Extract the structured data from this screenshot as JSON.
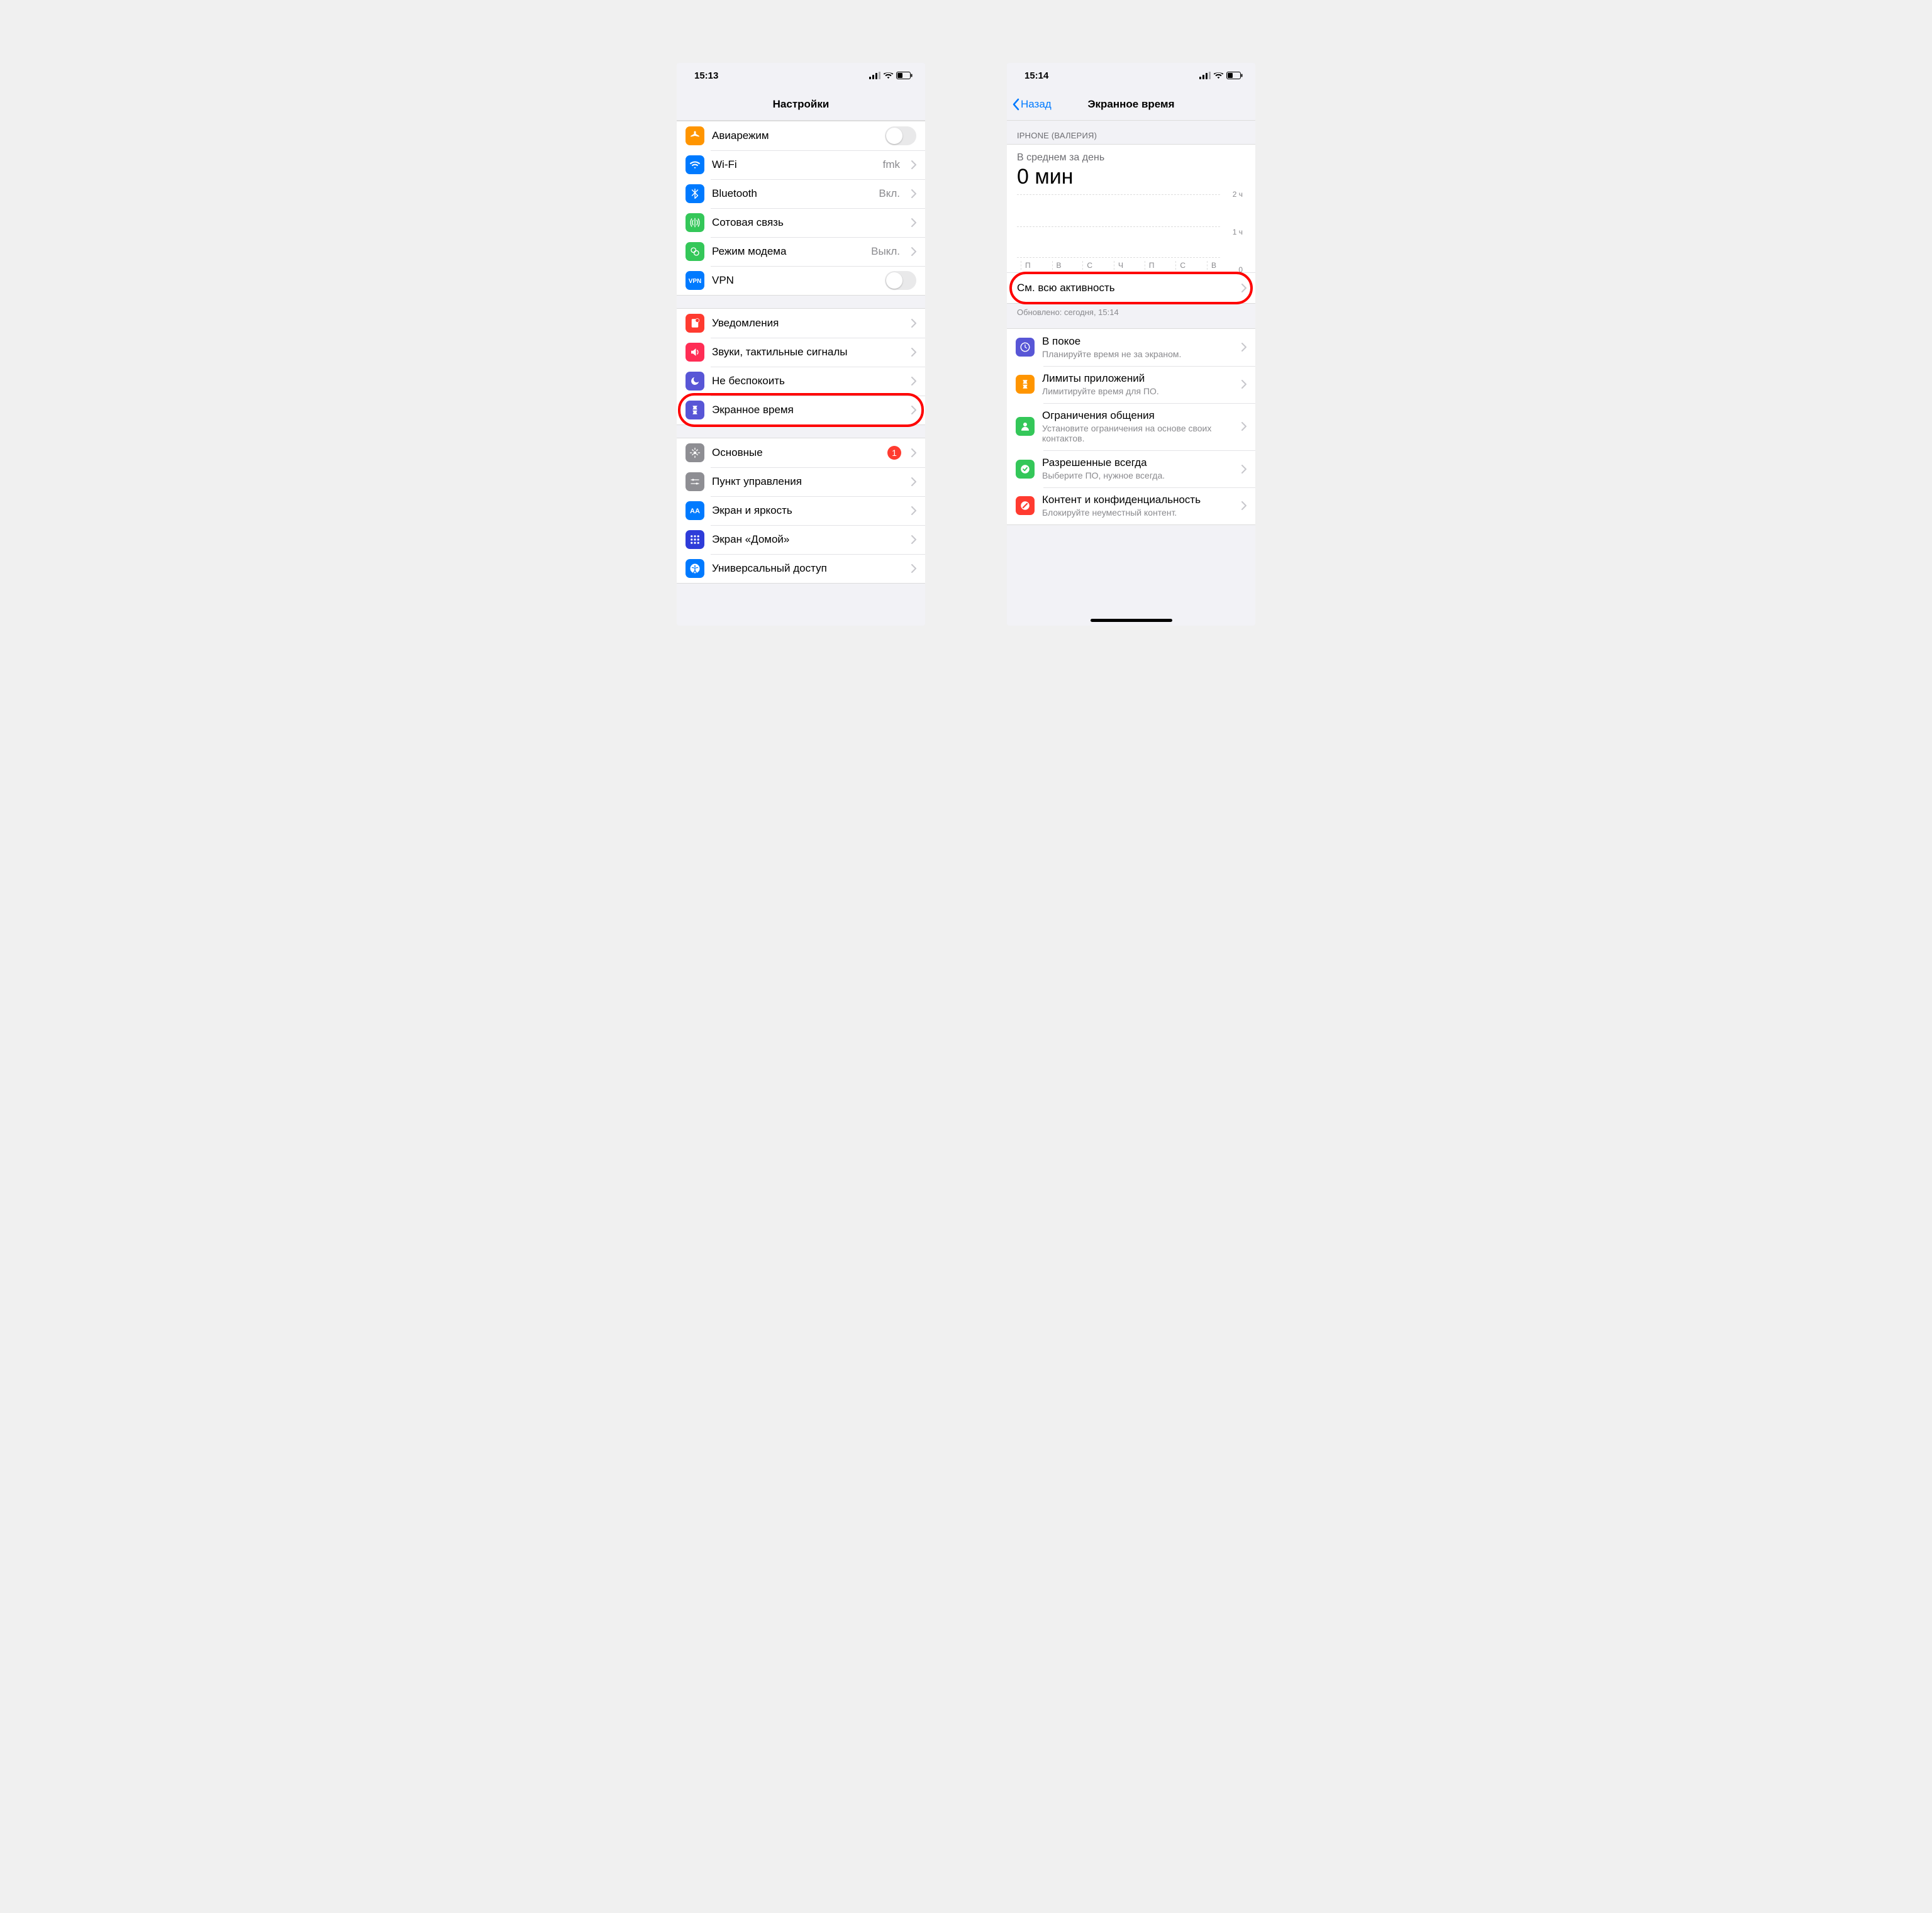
{
  "left": {
    "status": {
      "time": "15:13"
    },
    "nav": {
      "title": "Настройки"
    },
    "group1": [
      {
        "icon": "airplane",
        "color": "#ff9500",
        "label": "Авиарежим",
        "kind": "toggle"
      },
      {
        "icon": "wifi",
        "color": "#007aff",
        "label": "Wi-Fi",
        "value": "fmk",
        "kind": "chevron"
      },
      {
        "icon": "bluetooth",
        "color": "#007aff",
        "label": "Bluetooth",
        "value": "Вкл.",
        "kind": "chevron"
      },
      {
        "icon": "cellular",
        "color": "#34c759",
        "label": "Сотовая связь",
        "kind": "chevron"
      },
      {
        "icon": "hotspot",
        "color": "#34c759",
        "label": "Режим модема",
        "value": "Выкл.",
        "kind": "chevron"
      },
      {
        "icon": "vpn",
        "color": "#007aff",
        "label": "VPN",
        "kind": "toggle"
      }
    ],
    "group2": [
      {
        "icon": "notifications",
        "color": "#ff3b30",
        "label": "Уведомления",
        "kind": "chevron"
      },
      {
        "icon": "sounds",
        "color": "#ff2d55",
        "label": "Звуки, тактильные сигналы",
        "kind": "chevron"
      },
      {
        "icon": "dnd",
        "color": "#5856d6",
        "label": "Не беспокоить",
        "kind": "chevron"
      },
      {
        "icon": "screentime",
        "color": "#5856d6",
        "label": "Экранное время",
        "kind": "chevron",
        "highlight": true
      }
    ],
    "group3": [
      {
        "icon": "general",
        "color": "#8e8e93",
        "label": "Основные",
        "badge": "1",
        "kind": "chevron"
      },
      {
        "icon": "control",
        "color": "#8e8e93",
        "label": "Пункт управления",
        "kind": "chevron"
      },
      {
        "icon": "display",
        "color": "#007aff",
        "label": "Экран и яркость",
        "kind": "chevron"
      },
      {
        "icon": "home",
        "color": "#2e3cd9",
        "label": "Экран «Домой»",
        "kind": "chevron"
      },
      {
        "icon": "accessibility",
        "color": "#007aff",
        "label": "Универсальный доступ",
        "kind": "chevron"
      }
    ]
  },
  "right": {
    "status": {
      "time": "15:14"
    },
    "nav": {
      "back": "Назад",
      "title": "Экранное время"
    },
    "device_header": "IPHONE (ВАЛЕРИЯ)",
    "avg_label": "В среднем за день",
    "avg_value": "0 мин",
    "chart_y": {
      "top": "2 ч",
      "mid": "1 ч",
      "bottom": "0"
    },
    "chart_days": [
      "П",
      "В",
      "С",
      "Ч",
      "П",
      "С",
      "В"
    ],
    "see_all": "См. всю активность",
    "updated": "Обновлено: сегодня, 15:14",
    "features": [
      {
        "icon": "downtime",
        "color": "#5856d6",
        "title": "В покое",
        "sub": "Планируйте время не за экраном."
      },
      {
        "icon": "limits",
        "color": "#ff9500",
        "title": "Лимиты приложений",
        "sub": "Лимитируйте время для ПО."
      },
      {
        "icon": "commlimits",
        "color": "#34c759",
        "title": "Ограничения общения",
        "sub": "Установите ограничения на основе своих контактов."
      },
      {
        "icon": "allowed",
        "color": "#34c759",
        "title": "Разрешенные всегда",
        "sub": "Выберите ПО, нужное всегда."
      },
      {
        "icon": "privacy",
        "color": "#ff3b30",
        "title": "Контент и конфиденциальность",
        "sub": "Блокируйте неуместный контент."
      }
    ]
  },
  "chart_data": {
    "type": "bar",
    "categories": [
      "П",
      "В",
      "С",
      "Ч",
      "П",
      "С",
      "В"
    ],
    "values": [
      0,
      0,
      0,
      0,
      0,
      0,
      0
    ],
    "title": "В среднем за день: 0 мин",
    "xlabel": "",
    "ylabel": "часы",
    "ylim": [
      0,
      2
    ],
    "yticks": [
      0,
      1,
      2
    ]
  }
}
